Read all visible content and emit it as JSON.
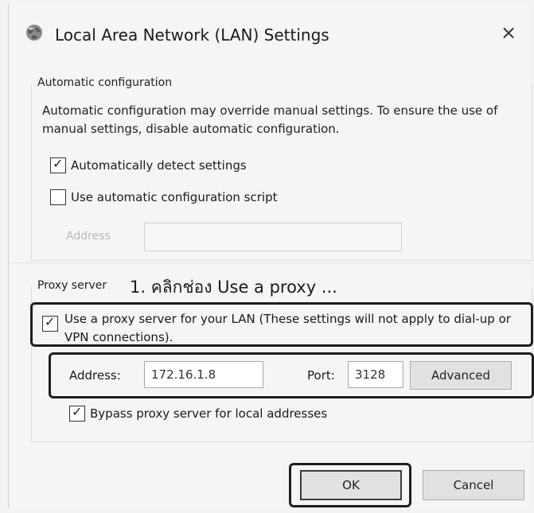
{
  "window": {
    "title": "Local Area Network (LAN) Settings",
    "icon": "globe-network-icon",
    "close_glyph": "×"
  },
  "automatic": {
    "group_label": "Automatic configuration",
    "description": "Automatic configuration may override manual settings.  To ensure the use of manual settings, disable automatic configuration.",
    "detect_settings": {
      "label": "Automatically detect settings",
      "checked": true
    },
    "config_script": {
      "label": "Use automatic configuration script",
      "checked": false
    },
    "address_label": "Address",
    "address_value": ""
  },
  "proxy": {
    "group_label": "Proxy server",
    "annotation": "1. คลิกช่อง Use a proxy ...",
    "use_proxy": {
      "label": "Use a proxy server for your LAN (These settings will not apply to dial-up or VPN connections).",
      "checked": true
    },
    "address_label": "Address:",
    "address_value": "172.16.1.8",
    "port_label": "Port:",
    "port_value": "3128",
    "advanced_button": "Advanced",
    "bypass": {
      "label": "Bypass proxy server for local addresses",
      "checked": true
    }
  },
  "buttons": {
    "ok": "OK",
    "cancel": "Cancel"
  },
  "check_glyph": "✓"
}
